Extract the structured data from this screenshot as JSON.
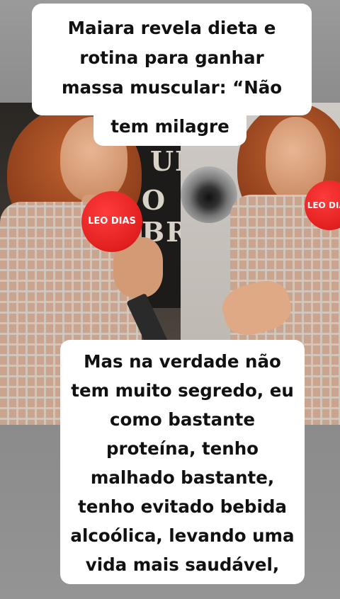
{
  "headline": {
    "lines": [
      "Maiara revela dieta e",
      "rotina para ganhar",
      "massa muscular: “Não",
      "tem milagre"
    ]
  },
  "quote": {
    "lines": [
      "Mas na verdade não",
      "tem muito segredo, eu",
      "como bastante",
      "proteína, tenho",
      "malhado bastante,",
      "tenho evitado bebida",
      "alcoólica, levando uma",
      "vida mais saudável,"
    ]
  },
  "photos": {
    "mic_brand_left": "LEO DIAS",
    "mic_brand_right": "LEO DIAS",
    "backdrop_text_1": "UME",
    "backdrop_text_2": "O BR"
  },
  "colors": {
    "caption_bg": "#ffffff",
    "caption_text": "#111111",
    "mic_red": "#e0201f"
  }
}
